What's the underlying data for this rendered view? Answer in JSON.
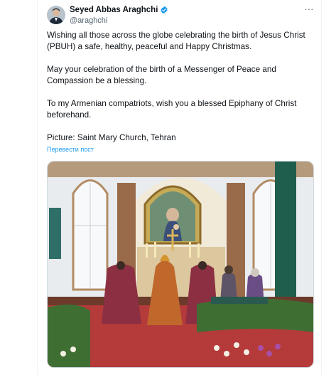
{
  "author": {
    "display_name": "Seyed Abbas Araghchi",
    "handle": "@araghchi",
    "verified": true
  },
  "tweet": {
    "paragraphs": [
      "Wishing all those across the globe celebrating the birth of Jesus Christ (PBUH) a safe, healthy, peaceful and Happy Christmas.",
      "May your celebration of the birth of a Messenger of Peace and Compassion be a blessing.",
      "To my Armenian compatriots, wish you a blessed Epiphany of Christ beforehand.",
      "Picture: Saint Mary Church, Tehran"
    ],
    "translate_label": "Перевести пост"
  },
  "icons": {
    "verified": "verified-badge-icon",
    "more": "more-options-icon"
  },
  "colors": {
    "accent": "#1d9bf0",
    "text": "#0f1419",
    "secondary_text": "#536471",
    "border": "#cfd9de"
  }
}
